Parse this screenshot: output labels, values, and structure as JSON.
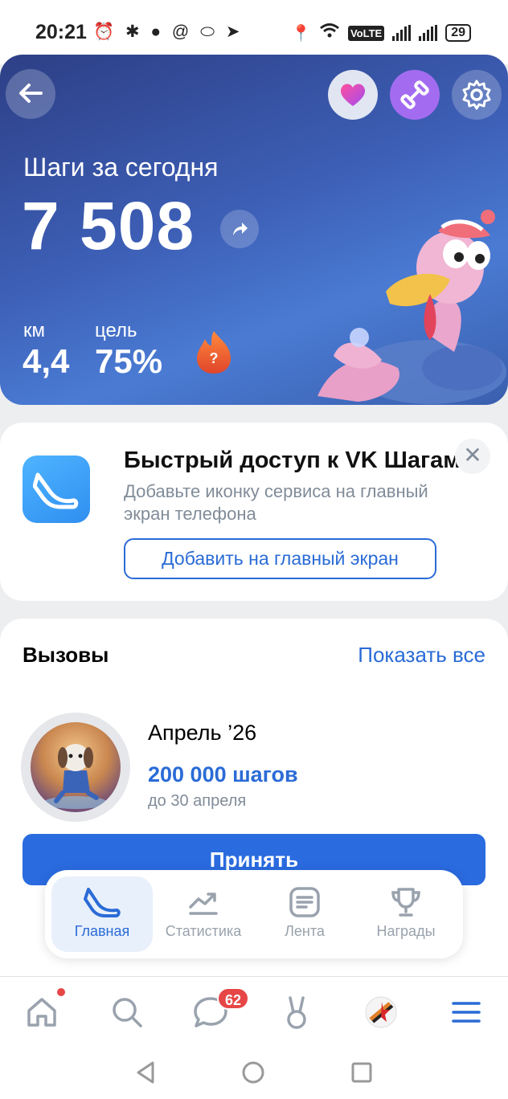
{
  "status_bar": {
    "time": "20:21",
    "icons_left": [
      "alarm-icon",
      "bluetooth-icon",
      "chat-icon",
      "at-icon",
      "vk-icon",
      "telegram-icon"
    ],
    "volte": "VoLTE",
    "battery": "29"
  },
  "hero": {
    "title": "Шаги за сегодня",
    "steps": "7 508",
    "km_label": "км",
    "km_value": "4,4",
    "goal_label": "цель",
    "goal_value": "75%",
    "fire_mark": "?"
  },
  "quick_access": {
    "title": "Быстрый доступ к VK Шагам",
    "text": "Добавьте иконку сервиса на главный экран телефона",
    "button": "Добавить на главный экран",
    "close": "✕"
  },
  "challenges": {
    "title": "Вызовы",
    "show_all": "Показать все",
    "month": "Апрель ’26",
    "goal": "200 000 шагов",
    "until": "до 30 апреля",
    "accept": "Принять"
  },
  "tabs": [
    {
      "label": "Главная",
      "icon": "sneaker-icon",
      "active": true
    },
    {
      "label": "Статистика",
      "icon": "chart-trend-icon",
      "active": false
    },
    {
      "label": "Лента",
      "icon": "feed-icon",
      "active": false
    },
    {
      "label": "Награды",
      "icon": "trophy-icon",
      "active": false
    }
  ],
  "vk_nav": {
    "messages_badge": "62"
  },
  "colors": {
    "accent": "#2a6bd6",
    "hero_top": "#2d3f86",
    "hero_bottom": "#4a7bd3",
    "badge": "#e64646"
  }
}
